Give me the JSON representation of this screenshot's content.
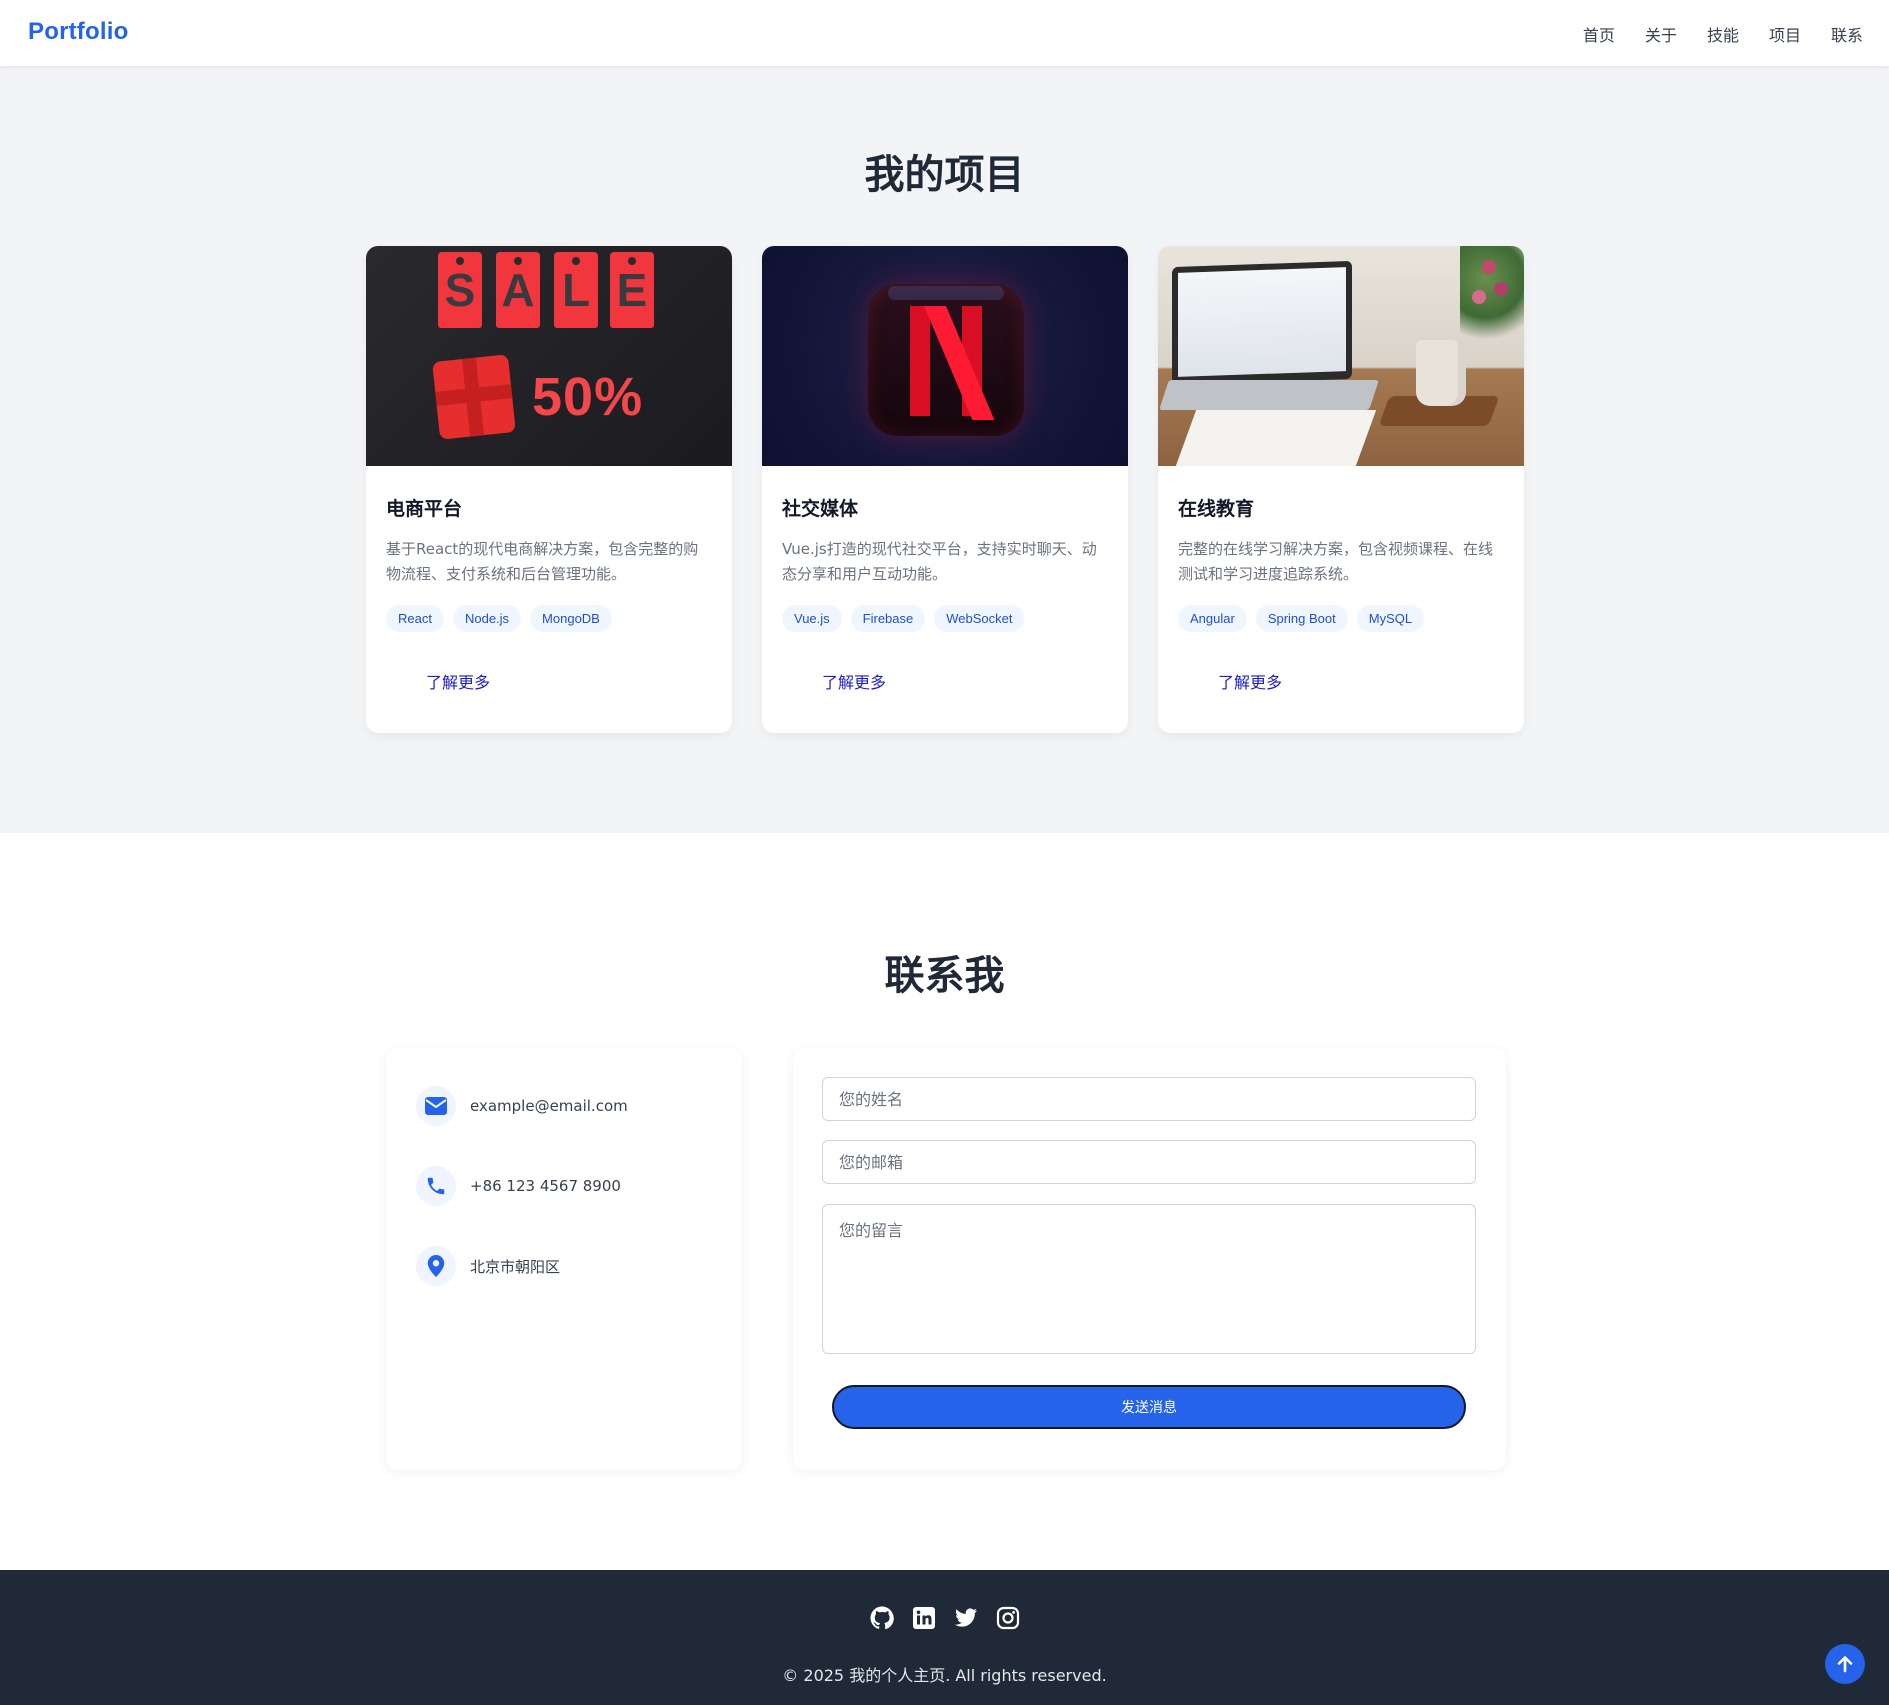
{
  "header": {
    "brand": "Portfolio",
    "nav": [
      "首页",
      "关于",
      "技能",
      "项目",
      "联系"
    ]
  },
  "projects": {
    "title": "我的项目",
    "items": [
      {
        "title": "电商平台",
        "desc": "基于React的现代电商解决方案，包含完整的购物流程、支付系统和后台管理功能。",
        "tags": [
          "React",
          "Node.js",
          "MongoDB"
        ],
        "more": "了解更多",
        "image_text": {
          "sale": [
            "S",
            "A",
            "L",
            "E"
          ],
          "pct": "50%"
        }
      },
      {
        "title": "社交媒体",
        "desc": "Vue.js打造的现代社交平台，支持实时聊天、动态分享和用户互动功能。",
        "tags": [
          "Vue.js",
          "Firebase",
          "WebSocket"
        ],
        "more": "了解更多"
      },
      {
        "title": "在线教育",
        "desc": "完整的在线学习解决方案，包含视频课程、在线测试和学习进度追踪系统。",
        "tags": [
          "Angular",
          "Spring Boot",
          "MySQL"
        ],
        "more": "了解更多"
      }
    ]
  },
  "contact": {
    "title": "联系我",
    "info": [
      {
        "icon": "envelope-icon",
        "text": "example@email.com"
      },
      {
        "icon": "phone-icon",
        "text": "+86 123 4567 8900"
      },
      {
        "icon": "location-pin-icon",
        "text": "北京市朝阳区"
      }
    ],
    "form": {
      "name_placeholder": "您的姓名",
      "email_placeholder": "您的邮箱",
      "message_placeholder": "您的留言",
      "submit_label": "发送消息"
    }
  },
  "footer": {
    "socials": [
      "github-icon",
      "linkedin-icon",
      "twitter-icon",
      "instagram-icon"
    ],
    "copyright": "© 2025 我的个人主页. All rights reserved."
  },
  "colors": {
    "accent": "#2563eb",
    "link": "#1e1ec8",
    "footer_bg": "#1f2937",
    "page_bg": "#f3f4f6"
  }
}
